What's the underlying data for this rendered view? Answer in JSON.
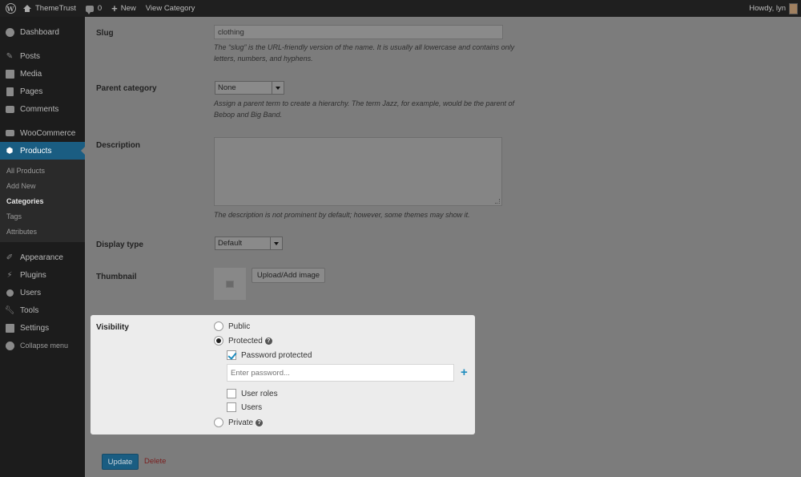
{
  "adminbar": {
    "site_name": "ThemeTrust",
    "comments_count": "0",
    "new_label": "New",
    "view_category": "View Category",
    "howdy": "Howdy, lyn"
  },
  "sidebar": {
    "items": [
      {
        "label": "Dashboard",
        "icon": "dashboard-icon"
      },
      {
        "label": "Posts",
        "icon": "pin-icon"
      },
      {
        "label": "Media",
        "icon": "media-icon"
      },
      {
        "label": "Pages",
        "icon": "pages-icon"
      },
      {
        "label": "Comments",
        "icon": "comments-icon"
      },
      {
        "label": "WooCommerce",
        "icon": "woocommerce-icon"
      },
      {
        "label": "Products",
        "icon": "products-icon"
      },
      {
        "label": "Appearance",
        "icon": "brush-icon"
      },
      {
        "label": "Plugins",
        "icon": "plugin-icon"
      },
      {
        "label": "Users",
        "icon": "users-icon"
      },
      {
        "label": "Tools",
        "icon": "wrench-icon"
      },
      {
        "label": "Settings",
        "icon": "settings-icon"
      },
      {
        "label": "Collapse menu",
        "icon": "collapse-icon"
      }
    ],
    "submenu": [
      "All Products",
      "Add New",
      "Categories",
      "Tags",
      "Attributes"
    ]
  },
  "form": {
    "slug_label": "Slug",
    "slug_value": "clothing",
    "slug_desc": "The “slug” is the URL-friendly version of the name. It is usually all lowercase and contains only letters, numbers, and hyphens.",
    "parent_label": "Parent category",
    "parent_value": "None",
    "parent_desc": "Assign a parent term to create a hierarchy. The term Jazz, for example, would be the parent of Bebop and Big Band.",
    "description_label": "Description",
    "description_desc": "The description is not prominent by default; however, some themes may show it.",
    "display_type_label": "Display type",
    "display_type_value": "Default",
    "thumbnail_label": "Thumbnail",
    "upload_button": "Upload/Add image"
  },
  "visibility": {
    "label": "Visibility",
    "public": "Public",
    "protected": "Protected",
    "password_protected": "Password protected",
    "password_placeholder": "Enter password...",
    "user_roles": "User roles",
    "users": "Users",
    "private": "Private",
    "selected": "protected"
  },
  "actions": {
    "update": "Update",
    "delete": "Delete"
  },
  "colors": {
    "accent": "#1a5d82",
    "add_icon": "#1e8cbe"
  }
}
